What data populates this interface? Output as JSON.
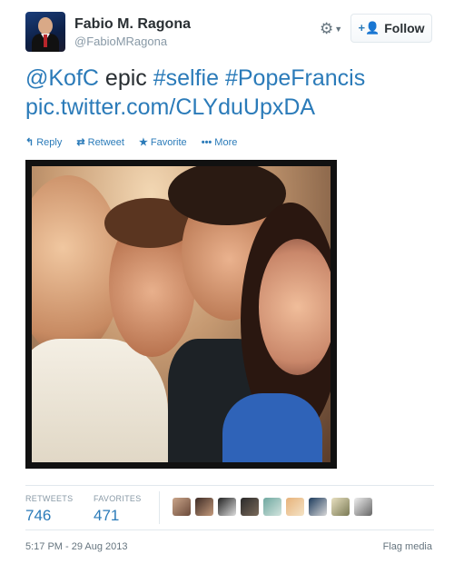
{
  "author": {
    "name": "Fabio M. Ragona",
    "handle": "@FabioMRagona"
  },
  "header": {
    "settings_icon": "gear-icon",
    "follow_label": "Follow",
    "follow_icon": "add-person-icon"
  },
  "tweet": {
    "mention": "@KofC",
    "word": "epic",
    "hashtag1": "#selfie",
    "hashtag2": "#PopeFrancis",
    "link": "pic.twitter.com/CLYduUpxDA"
  },
  "actions": {
    "reply": "Reply",
    "retweet": "Retweet",
    "favorite": "Favorite",
    "more": "More"
  },
  "stats": {
    "retweets_label": "RETWEETS",
    "retweets_count": "746",
    "favorites_label": "FAVORITES",
    "favorites_count": "471"
  },
  "footer": {
    "timestamp": "5:17 PM - 29 Aug 2013",
    "flag_label": "Flag media"
  },
  "colors": {
    "link": "#2b7bb9",
    "text": "#292f33",
    "muted": "#8899a6"
  }
}
